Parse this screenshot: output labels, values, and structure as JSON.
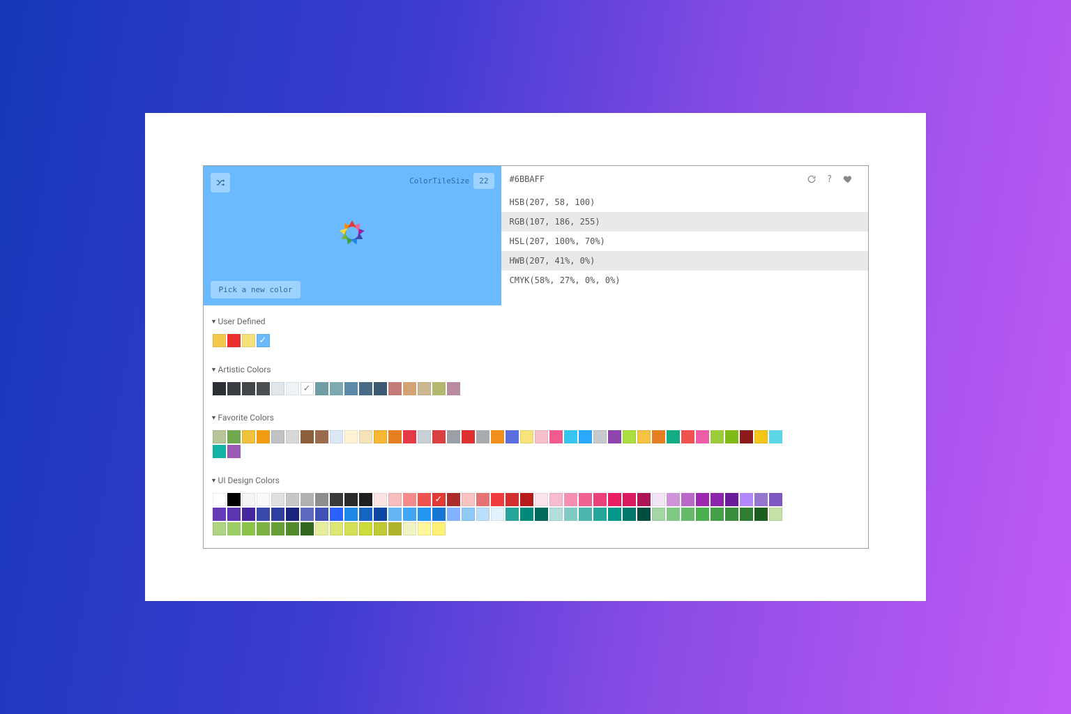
{
  "preview": {
    "background": "#6BBAFF",
    "tile_size_label": "ColorTileSize",
    "tile_size_value": "22",
    "pick_label": "Pick a new color",
    "wheel_colors": [
      "#e53935",
      "#f06292",
      "#8e24aa",
      "#3949ab",
      "#1e88e5",
      "#43a047",
      "#7cb342",
      "#fdd835",
      "#fb8c00"
    ]
  },
  "values": {
    "hex": "#6BBAFF",
    "rows": [
      "HSB(207, 58, 100)",
      "RGB(107, 186, 255)",
      "HSL(207, 100%, 70%)",
      "HWB(207, 41%, 0%)",
      "CMYK(58%, 27%, 0%, 0%)"
    ]
  },
  "sections": {
    "user_defined": {
      "title": "User Defined",
      "colors": [
        "#f2c94c",
        "#eb2f2f",
        "#f6e27a",
        "#6bbaff"
      ],
      "selected_index": 3
    },
    "artistic": {
      "title": "Artistic Colors",
      "colors": [
        "#2c2f33",
        "#3a3d41",
        "#444749",
        "#4c4f52",
        "#dfe6ec",
        "#eef3f7",
        "#ffffff",
        "#6f9da3",
        "#7fa9b0",
        "#5d8aa8",
        "#4a6b86",
        "#3d5a73",
        "#c27d78",
        "#d4a373",
        "#cdb891",
        "#b4b86f",
        "#b98ca1"
      ],
      "selected_index": 6
    },
    "favorite": {
      "title": "Favorite Colors",
      "colors": [
        "#b7c59b",
        "#6fa84d",
        "#f0c23b",
        "#f39c12",
        "#bfc3c6",
        "#d8d8d8",
        "#8b5e3c",
        "#9c6b4e",
        "#dce8f5",
        "#fff3d6",
        "#f4e2b8",
        "#f7b733",
        "#e67e22",
        "#e63946",
        "#c9d0d6",
        "#d94040",
        "#9aa0a6",
        "#e03131",
        "#a7abad",
        "#f28e1c",
        "#5b6ee1",
        "#f7e37a",
        "#f7bfc9",
        "#f15b8e",
        "#36c5f0",
        "#2aa7ff",
        "#c7cacc",
        "#8e44ad",
        "#aadf3f",
        "#f5c242",
        "#e67e22",
        "#10ac84",
        "#f0534f",
        "#ef5da8",
        "#9ccc3c",
        "#80b918",
        "#8d1b1b",
        "#f5c518",
        "#5dd6e8",
        "#12b5a5",
        "#9b59b6"
      ]
    },
    "ui_design": {
      "title": "UI Design Colors",
      "colors": [
        "#ffffff",
        "#000000",
        "#f5f5f5",
        "#fafafa",
        "#e0e0e0",
        "#c7c7c7",
        "#b0b0b0",
        "#8d8d8d",
        "#3a3a3a",
        "#2b2b2b",
        "#1f1f1f",
        "#fde4e4",
        "#f8bdbd",
        "#f58a8a",
        "#ef5350",
        "#e53935",
        "#ac2b2b",
        "#f8c2c2",
        "#e57373",
        "#ef3d3d",
        "#d32f2f",
        "#b71c1c",
        "#fce4ec",
        "#f8bbd0",
        "#f48fb1",
        "#f06292",
        "#ec407a",
        "#e91e63",
        "#d81b60",
        "#ad1457",
        "#f3e5f5",
        "#ce93d8",
        "#ba68c8",
        "#9c27b0",
        "#8e24aa",
        "#6a1b9a",
        "#b388ff",
        "#9575cd",
        "#7e57c2",
        "#673ab7",
        "#5e35b1",
        "#4527a0",
        "#3949ab",
        "#303f9f",
        "#1a237e",
        "#5c6bc0",
        "#3f51b5",
        "#2962ff",
        "#1e88e5",
        "#1565c0",
        "#0d47a1",
        "#64b5f6",
        "#42a5f5",
        "#2196f3",
        "#1976d2",
        "#82b1ff",
        "#90caf9",
        "#bbdefb",
        "#e3f2fd",
        "#26a69a",
        "#00897b",
        "#00695c",
        "#b2dfdb",
        "#80cbc4",
        "#4db6ac",
        "#26a69a",
        "#009688",
        "#00796b",
        "#004d40",
        "#a5d6a7",
        "#81c784",
        "#66bb6a",
        "#4caf50",
        "#43a047",
        "#388e3c",
        "#2e7d32",
        "#1b5e20",
        "#c5e1a5",
        "#aed581",
        "#9ccc65",
        "#8bc34a",
        "#7cb342",
        "#689f38",
        "#558b2f",
        "#33691e",
        "#e6ee9c",
        "#dce775",
        "#d4e157",
        "#cddc39",
        "#c0ca33",
        "#afb42b",
        "#f0f4c3",
        "#fff59d",
        "#fff176"
      ],
      "selected_index": 15
    }
  }
}
